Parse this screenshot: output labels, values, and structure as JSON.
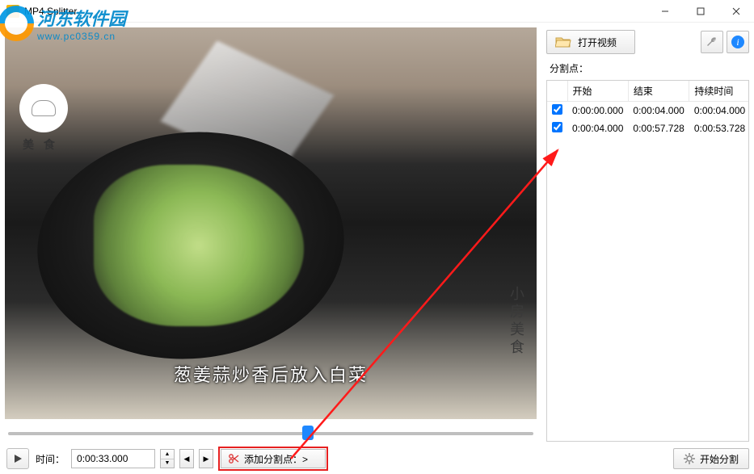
{
  "window": {
    "title": "MP4 Splitter"
  },
  "watermark": {
    "title": "河东软件园",
    "url": "www.pc0359.cn"
  },
  "video": {
    "chef_label": "美  食",
    "side_text": "小房美食",
    "subtitle": "葱姜蒜炒香后放入白菜"
  },
  "controls": {
    "time_label": "时间：",
    "time_value": "0:00:33.000",
    "add_split_label": "添加分割点：>"
  },
  "right": {
    "open_video": "打开视频",
    "split_points_label": "分割点：",
    "headers": {
      "start": "开始",
      "end": "结束",
      "duration": "持续时间"
    },
    "rows": [
      {
        "checked": true,
        "start": "0:00:00.000",
        "end": "0:00:04.000",
        "duration": "0:00:04.000"
      },
      {
        "checked": true,
        "start": "0:00:04.000",
        "end": "0:00:57.728",
        "duration": "0:00:53.728"
      }
    ],
    "start_split": "开始分割"
  },
  "icons": {
    "folder": "folder-open-icon",
    "wrench": "wrench-icon",
    "info": "info-icon",
    "play": "play-icon",
    "scissors": "scissors-icon",
    "gear": "gear-icon"
  }
}
